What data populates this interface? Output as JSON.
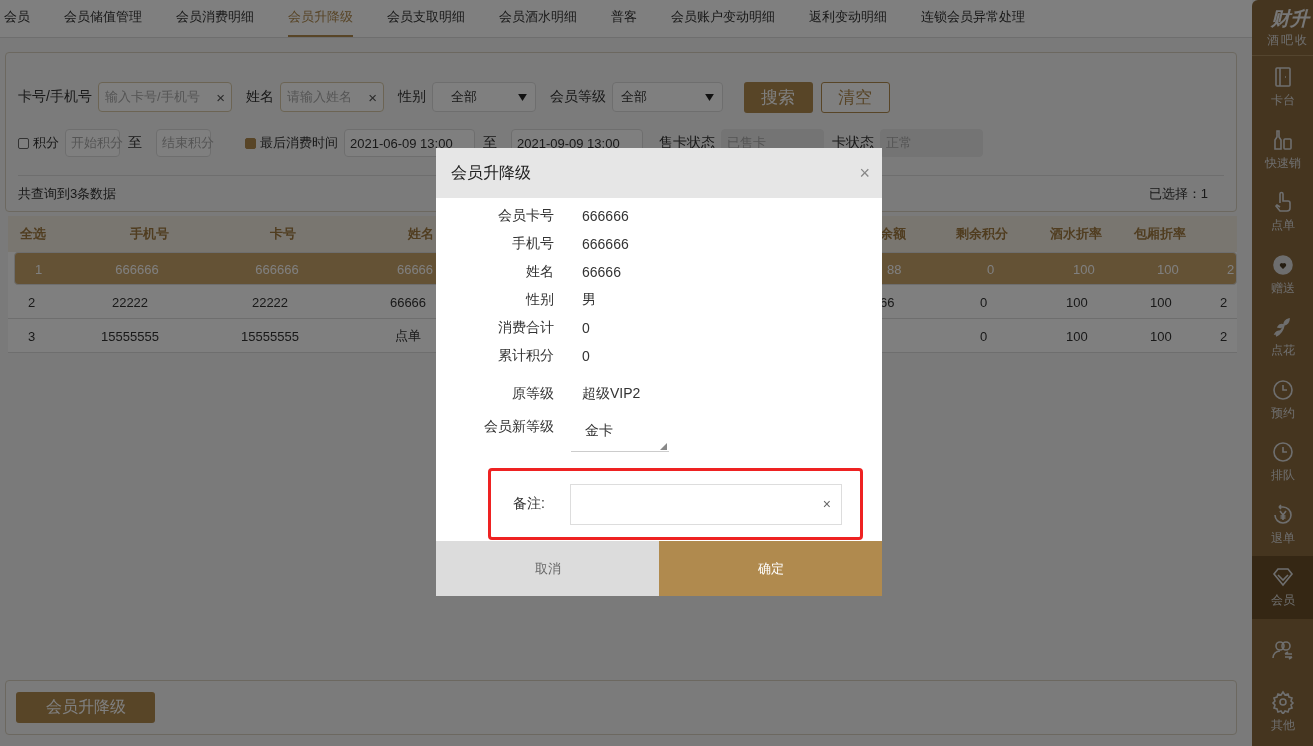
{
  "top_tabs": [
    {
      "label": "会员",
      "selected": false
    },
    {
      "label": "会员储值管理",
      "selected": false
    },
    {
      "label": "会员消费明细",
      "selected": false
    },
    {
      "label": "会员升降级",
      "selected": true
    },
    {
      "label": "会员支取明细",
      "selected": false
    },
    {
      "label": "会员酒水明细",
      "selected": false
    },
    {
      "label": "普客",
      "selected": false
    },
    {
      "label": "会员账户变动明细",
      "selected": false
    },
    {
      "label": "返利变动明细",
      "selected": false
    },
    {
      "label": "连锁会员异常处理",
      "selected": false
    }
  ],
  "filters": {
    "card": {
      "label": "卡号/手机号",
      "placeholder": "输入卡号/手机号",
      "clear": "×"
    },
    "name": {
      "label": "姓名",
      "placeholder": "请输入姓名",
      "clear": "×"
    },
    "gender": {
      "label": "性别",
      "value": "全部"
    },
    "level": {
      "label": "会员等级",
      "value": "全部"
    },
    "search_button": "搜索",
    "clear_button": "清空",
    "points": {
      "label": "积分",
      "checked": false,
      "from_placeholder": "开始积分",
      "to": "至",
      "to_placeholder": "结束积分"
    },
    "last_consume": {
      "label": "最后消费时间",
      "checked": true,
      "from": "2021-06-09 13:00",
      "to": "至",
      "to_value": "2021-09-09 13:00"
    },
    "sold_status": {
      "label": "售卡状态",
      "placeholder": "已售卡"
    },
    "card_status": {
      "label": "卡状态",
      "placeholder": "正常"
    },
    "result_count": "共查询到3条数据",
    "selected_count": "已选择：1"
  },
  "table": {
    "columns": [
      "全选",
      "手机号",
      "卡号",
      "姓名",
      "余额",
      "剩余积分",
      "酒水折率",
      "包厢折率"
    ],
    "rows": [
      {
        "selected": true,
        "cells": [
          "1",
          "666666",
          "666666",
          "66666",
          "88",
          "0",
          "100",
          "100",
          "2"
        ]
      },
      {
        "selected": false,
        "cells": [
          "2",
          "22222",
          "22222",
          "66666",
          "66",
          "0",
          "100",
          "100",
          "2"
        ]
      },
      {
        "selected": false,
        "cells": [
          "3",
          "15555555",
          "15555555",
          "点单",
          null,
          "0",
          "100",
          "100",
          "2"
        ]
      }
    ]
  },
  "bottom_button": "会员升降级",
  "sidebar": {
    "logo": "财升",
    "subtitle": "酒吧收",
    "items": [
      {
        "label": "卡台",
        "selected": false
      },
      {
        "label": "快速销",
        "selected": false
      },
      {
        "label": "点单",
        "selected": false
      },
      {
        "label": "赠送",
        "selected": false
      },
      {
        "label": "点花",
        "selected": false
      },
      {
        "label": "预约",
        "selected": false
      },
      {
        "label": "排队",
        "selected": false
      },
      {
        "label": "退单",
        "selected": false
      },
      {
        "label": "会员",
        "selected": true
      },
      {
        "selected": false
      },
      {
        "label": "其他",
        "selected": false
      }
    ]
  },
  "dialog": {
    "title": "会员升降级",
    "close": "×",
    "fields": [
      {
        "label": "会员卡号",
        "value": "666666"
      },
      {
        "label": "手机号",
        "value": "666666"
      },
      {
        "label": "姓名",
        "value": "66666"
      },
      {
        "label": "性别",
        "value": "男"
      },
      {
        "label": "消费合计",
        "value": "0"
      },
      {
        "label": "累计积分",
        "value": "0"
      }
    ],
    "original_level": {
      "label": "原等级",
      "value": "超级VIP2"
    },
    "new_level": {
      "label": "会员新等级",
      "value": "金卡"
    },
    "remark": {
      "label": "备注:",
      "clear": "×",
      "highlighted": true
    },
    "cancel_button": "取消",
    "confirm_button": "确定"
  }
}
